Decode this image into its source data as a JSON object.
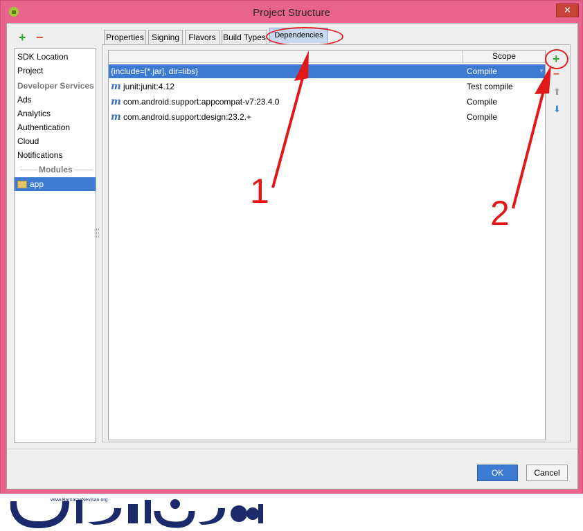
{
  "window": {
    "title": "Project Structure",
    "close_glyph": "✕"
  },
  "left_panel": {
    "add_glyph": "+",
    "remove_glyph": "−",
    "items": [
      {
        "label": "SDK Location"
      },
      {
        "label": "Project"
      },
      {
        "label": "Developer Services",
        "header": true
      },
      {
        "label": "Ads"
      },
      {
        "label": "Analytics"
      },
      {
        "label": "Authentication"
      },
      {
        "label": "Cloud"
      },
      {
        "label": "Notifications"
      }
    ],
    "modules_label": "Modules",
    "module_item": "app"
  },
  "tabs": [
    {
      "label": "Properties"
    },
    {
      "label": "Signing"
    },
    {
      "label": "Flavors"
    },
    {
      "label": "Build Types"
    },
    {
      "label": "Dependencies",
      "active": true
    }
  ],
  "dependencies": {
    "scope_header": "Scope",
    "rows": [
      {
        "name": "{include=[*.jar], dir=libs}",
        "scope": "Compile",
        "maven": false,
        "selected": true
      },
      {
        "name": "junit:junit:4.12",
        "scope": "Test compile",
        "maven": true
      },
      {
        "name": "com.android.support:appcompat-v7:23.4.0",
        "scope": "Compile",
        "maven": true
      },
      {
        "name": "com.android.support:design:23.2.+",
        "scope": "Compile",
        "maven": true
      }
    ],
    "maven_glyph": "m",
    "dropdown_glyph": "▼"
  },
  "side_toolbar": {
    "add_glyph": "+",
    "remove_glyph": "−",
    "up_glyph": "⬆",
    "down_glyph": "⬇"
  },
  "buttons": {
    "ok": "OK",
    "cancel": "Cancel"
  },
  "annotations": {
    "label_1": "1",
    "label_2": "2",
    "color": "#e01818"
  },
  "watermark": {
    "url": "www.BarnameNevisan.org",
    "logo_text": "برنامه نویسان"
  },
  "colors": {
    "window_frame": "#e8648c",
    "selection": "#3d7ad2",
    "add_green": "#2fa52f",
    "remove_red": "#d9503f"
  },
  "icons": [
    "android-app-icon",
    "close-icon",
    "add-icon",
    "remove-icon",
    "folder-icon",
    "maven-icon",
    "dropdown-icon",
    "arrow-up-icon",
    "arrow-down-icon"
  ]
}
